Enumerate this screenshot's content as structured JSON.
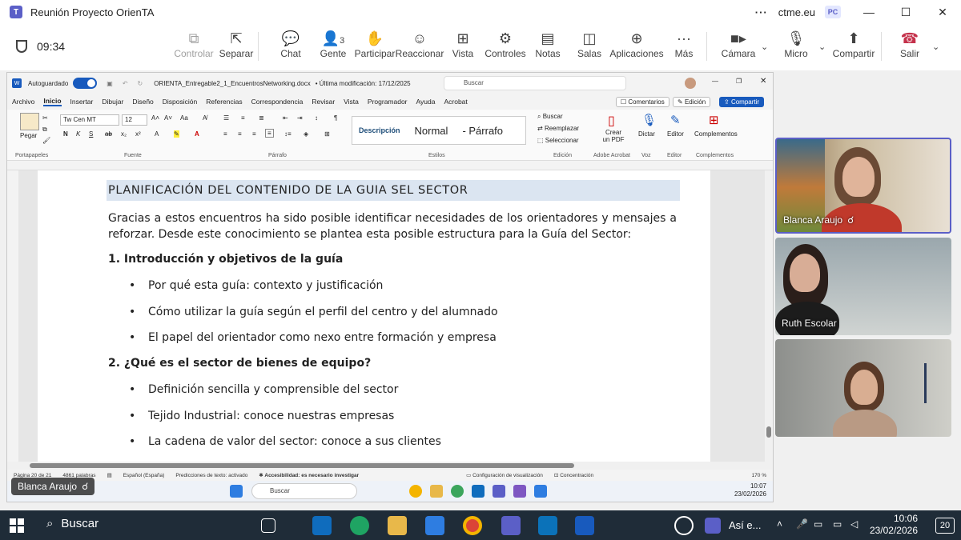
{
  "teams": {
    "window_title": "Reunión Proyecto OrienTA",
    "org": "ctme.eu",
    "user_initials": "PC",
    "timer": "09:34",
    "toolbar": [
      {
        "label": "Controlar",
        "icon": "control-icon",
        "disabled": true
      },
      {
        "label": "Separar",
        "icon": "popout-icon"
      },
      {
        "label": "Chat",
        "icon": "chat-icon"
      },
      {
        "label": "Gente",
        "icon": "people-icon",
        "count": "3"
      },
      {
        "label": "Participar",
        "icon": "raise-hand-icon"
      },
      {
        "label": "Reaccionar",
        "icon": "smile-icon"
      },
      {
        "label": "Vista",
        "icon": "grid-icon"
      },
      {
        "label": "Controles",
        "icon": "controls-icon"
      },
      {
        "label": "Notas",
        "icon": "notes-icon"
      },
      {
        "label": "Salas",
        "icon": "rooms-icon"
      },
      {
        "label": "Aplicaciones",
        "icon": "add-apps-icon"
      },
      {
        "label": "Más",
        "icon": "more-icon"
      },
      {
        "label": "Cámara",
        "icon": "camera-icon"
      },
      {
        "label": "Micro",
        "icon": "mic-icon"
      },
      {
        "label": "Compartir",
        "icon": "share-icon"
      },
      {
        "label": "Salir",
        "icon": "hangup-icon"
      }
    ],
    "presenter_name": "Blanca Araujo",
    "participants": [
      {
        "name": "Blanca Araujo",
        "active": true
      },
      {
        "name": "Ruth Escolar"
      },
      {
        "name": ""
      }
    ],
    "accent": "#5b5fc7",
    "leave_color": "#c4314b"
  },
  "word": {
    "autosave_label": "Autoguardado",
    "doc_title": "ORIENTA_Entregable2_1_EncuentrosNetworking.docx",
    "modified": "• Última modificación: 17/12/2025",
    "search_placeholder": "Buscar",
    "menu": [
      "Archivo",
      "Inicio",
      "Insertar",
      "Dibujar",
      "Diseño",
      "Disposición",
      "Referencias",
      "Correspondencia",
      "Revisar",
      "Vista",
      "Programador",
      "Ayuda",
      "Acrobat"
    ],
    "comments_label": "Comentarios",
    "edit_label": "Edición",
    "share_label": "Compartir",
    "font_name": "Tw Cen MT",
    "font_size": "12",
    "paste_label": "Pegar",
    "groups": {
      "clipboard": "Portapapeles",
      "font": "Fuente",
      "paragraph": "Párrafo",
      "styles": "Estilos",
      "editing": "Edición",
      "adobe": "Adobe Acrobat",
      "voice": "Voz",
      "editor": "Editor",
      "addins": "Complementos"
    },
    "styles": [
      "Descripción",
      "Normal",
      "- Párrafo"
    ],
    "find_label": "Buscar",
    "replace_label": "Reemplazar",
    "select_label": "Seleccionar",
    "pdf_label": "Crear un PDF",
    "dictate_label": "Dictar",
    "editor_label": "Editor",
    "addins_label": "Complementos",
    "document": {
      "heading": "PLANIFICACIÓN DEL CONTENIDO DE LA GUIA SEL SECTOR",
      "intro": "Gracias a estos encuentros ha sido posible identificar necesidades de los orientadores y mensajes a reforzar. Desde este conocimiento se plantea esta posible estructura para la Guía del Sector:",
      "section1": "1. Introducción y objetivos de la guía",
      "bullets1": [
        "Por qué esta guía: contexto y justificación",
        "Cómo utilizar la guía según el perfil del centro y del alumnado",
        "El papel del orientador como nexo entre formación y empresa"
      ],
      "section2": "2. ¿Qué es el sector de bienes de equipo?",
      "bullets2": [
        "Definición sencilla y comprensible del sector",
        "Tejido Industrial: conoce nuestras empresas",
        "La cadena de valor del sector: conoce a sus clientes"
      ]
    },
    "status": {
      "page": "Página 20 de 21",
      "words": "4861 palabras",
      "language": "Español (España)",
      "predictions": "Predicciones de texto: activado",
      "accessibility": "Accesibilidad: es necesario investigar",
      "display": "Configuración de visualización",
      "focus": "Concentración",
      "zoom": "170 %"
    },
    "inner_taskbar": {
      "search": "Buscar",
      "time": "10:07",
      "date": "23/02/2026"
    }
  },
  "windows_taskbar": {
    "search": "Buscar",
    "media_text": "Así e...",
    "time": "10:06",
    "date": "23/02/2026",
    "notifications": "20"
  }
}
